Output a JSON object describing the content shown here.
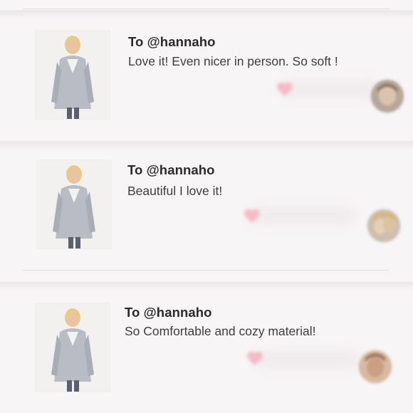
{
  "comments": [
    {
      "to": "To @hannaho",
      "message": "Love it! Even nicer in person. So soft !",
      "thumb_icon": "cardigan-product-photo",
      "avatar_icon": "commenter-avatar"
    },
    {
      "to": "To @hannaho",
      "message": "Beautiful I love it!",
      "thumb_icon": "cardigan-product-photo",
      "avatar_icon": "commenter-avatar"
    },
    {
      "to": "To @hannaho",
      "message": "So Comfortable and cozy material!",
      "thumb_icon": "cardigan-product-photo",
      "avatar_icon": "commenter-avatar"
    }
  ],
  "colors": {
    "background": "#f8f5f6",
    "heart": "#f6b9c6",
    "text_primary": "#2a2a2a",
    "text_secondary": "#3d3d3d"
  }
}
